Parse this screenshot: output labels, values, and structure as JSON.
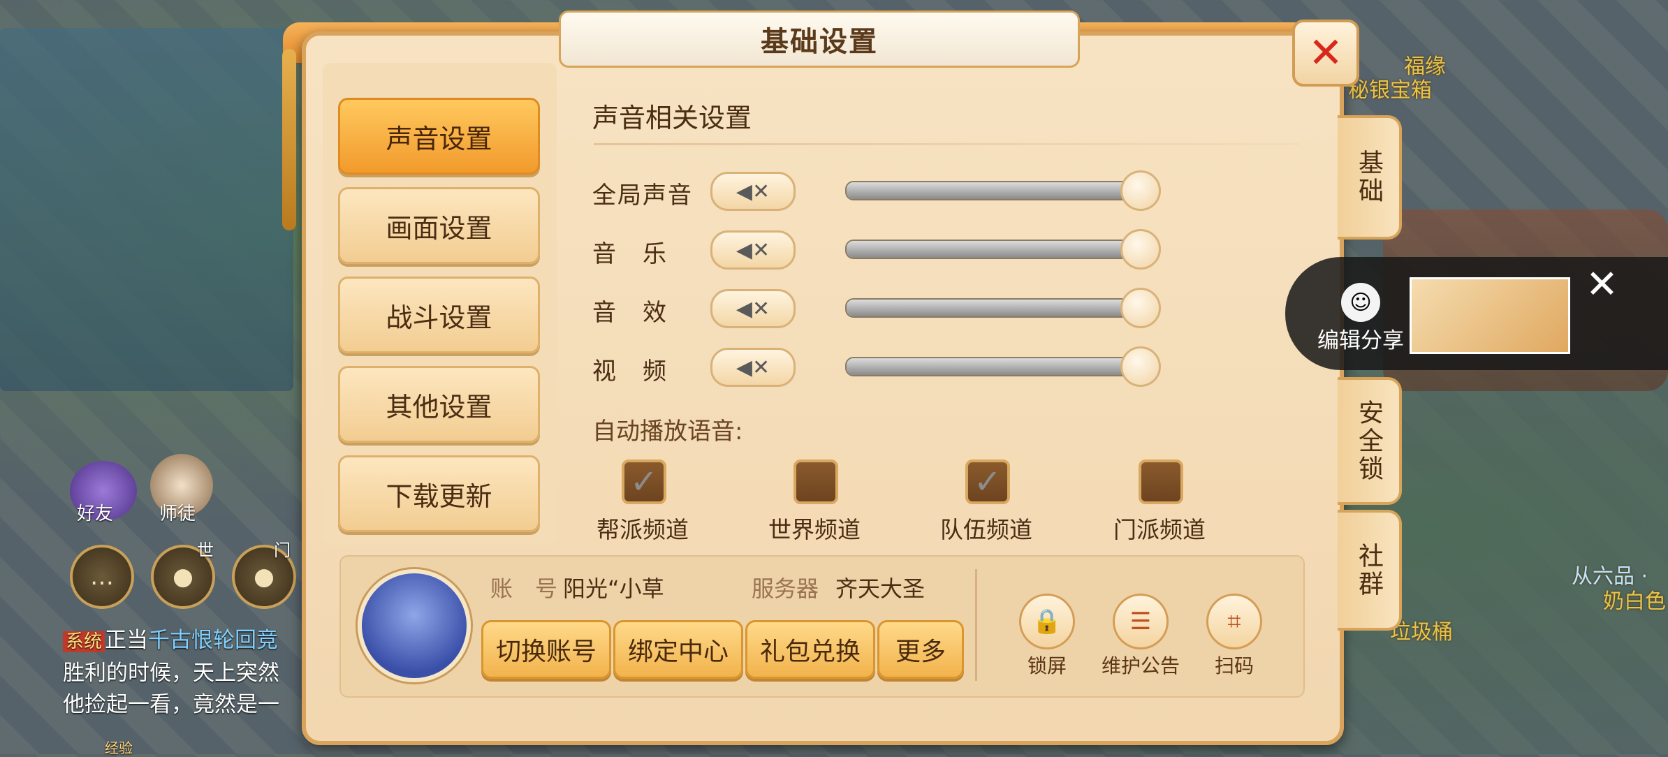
{
  "window": {
    "title": "基础设置",
    "close_icon": "close-icon"
  },
  "nav": {
    "items": [
      {
        "label": "声音设置",
        "active": true
      },
      {
        "label": "画面设置",
        "active": false
      },
      {
        "label": "战斗设置",
        "active": false
      },
      {
        "label": "其他设置",
        "active": false
      },
      {
        "label": "下载更新",
        "active": false
      }
    ]
  },
  "sound": {
    "section_title": "声音相关设置",
    "rows": [
      {
        "label": "全局声音",
        "volume": 1.0,
        "muted_icon": "speaker-muted-icon"
      },
      {
        "label": "音　乐",
        "volume": 1.0,
        "muted_icon": "speaker-muted-icon"
      },
      {
        "label": "音　效",
        "volume": 1.0,
        "muted_icon": "speaker-muted-icon"
      },
      {
        "label": "视　频",
        "volume": 1.0,
        "muted_icon": "speaker-muted-icon"
      }
    ],
    "auto_voice_label": "自动播放语音:",
    "channels": [
      {
        "label": "帮派频道",
        "checked": true
      },
      {
        "label": "世界频道",
        "checked": false
      },
      {
        "label": "队伍频道",
        "checked": true
      },
      {
        "label": "门派频道",
        "checked": false
      }
    ]
  },
  "account": {
    "account_key": "账　号",
    "account_value": "阳光“小草",
    "server_key": "服务器",
    "server_value": "齐天大圣",
    "buttons": [
      "切换账号",
      "绑定中心",
      "礼包兑换",
      "更多"
    ],
    "tools": [
      {
        "label": "锁屏",
        "icon": "lock-icon"
      },
      {
        "label": "维护公告",
        "icon": "notice-icon"
      },
      {
        "label": "扫码",
        "icon": "scan-icon"
      }
    ]
  },
  "side_tabs": [
    "基础",
    "安全锁",
    "社群"
  ],
  "share": {
    "label": "编辑分享"
  },
  "background": {
    "top_right_1": "福缘",
    "top_right_2": "秘银宝箱",
    "friends": "好友",
    "mentor": "师徒",
    "world_mark": "世",
    "sect_mark": "门",
    "chat_tag": "系统",
    "chat_line1_a": "正当",
    "chat_line1_b": "千古恨轮回竞",
    "chat_line2": "胜利的时候，天上突然",
    "chat_line3": "他捡起一看，竟然是一",
    "right_mid_1": "从六品 · ",
    "right_mid_2": "奶白色",
    "bottom_right": "垃圾桶",
    "bottom_left": "经验"
  },
  "colors": {
    "accent": "#f29a2c",
    "close": "#d8281b",
    "panel": "#f7e3c2"
  }
}
